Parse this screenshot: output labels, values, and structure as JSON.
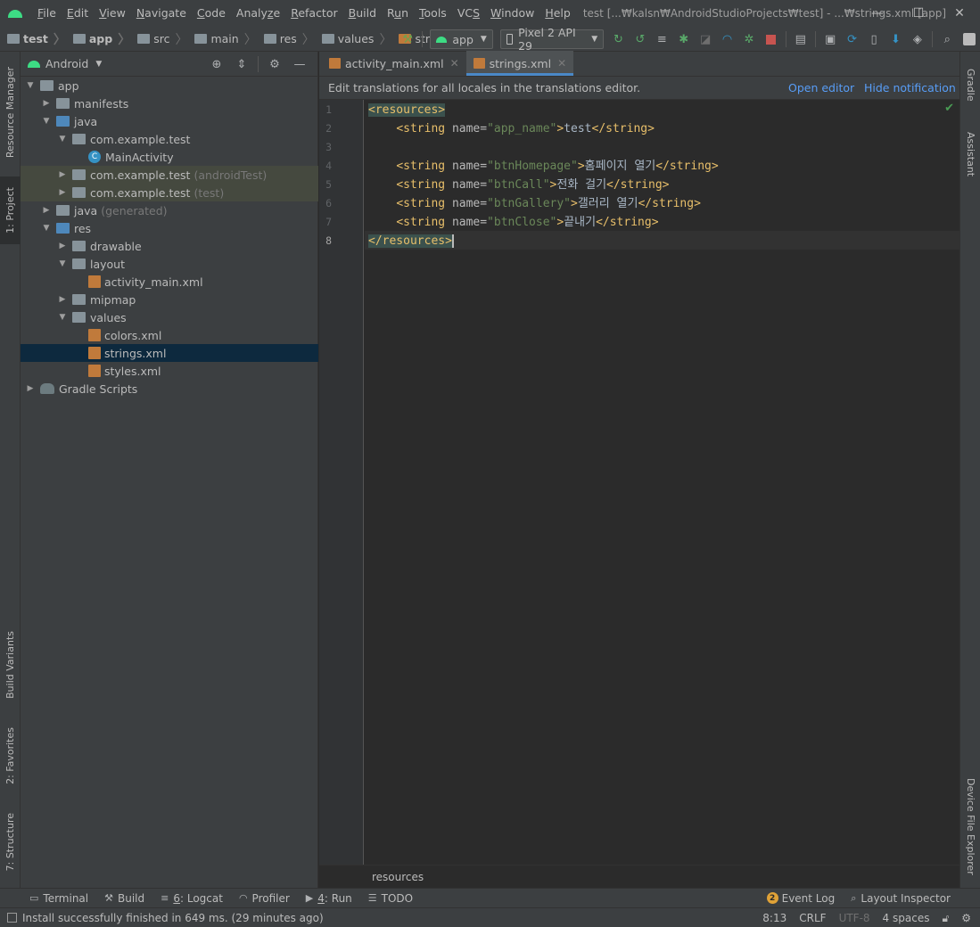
{
  "window": {
    "title": "test [...₩kalsn₩AndroidStudioProjects₩test] - ...₩strings.xml [app]",
    "minimize_glyph": "—",
    "maximize_glyph": "☐",
    "close_glyph": "✕"
  },
  "menu": [
    {
      "pre": "",
      "u": "F",
      "post": "ile"
    },
    {
      "pre": "",
      "u": "E",
      "post": "dit"
    },
    {
      "pre": "",
      "u": "V",
      "post": "iew"
    },
    {
      "pre": "",
      "u": "N",
      "post": "avigate"
    },
    {
      "pre": "",
      "u": "C",
      "post": "ode"
    },
    {
      "pre": "Analy",
      "u": "z",
      "post": "e"
    },
    {
      "pre": "",
      "u": "R",
      "post": "efactor"
    },
    {
      "pre": "",
      "u": "B",
      "post": "uild"
    },
    {
      "pre": "R",
      "u": "u",
      "post": "n"
    },
    {
      "pre": "",
      "u": "T",
      "post": "ools"
    },
    {
      "pre": "VC",
      "u": "S",
      "post": ""
    },
    {
      "pre": "",
      "u": "W",
      "post": "indow"
    },
    {
      "pre": "",
      "u": "H",
      "post": "elp"
    }
  ],
  "breadcrumbs": [
    {
      "label": "test",
      "bold": true
    },
    {
      "label": "app",
      "bold": true
    },
    {
      "label": "src",
      "bold": false
    },
    {
      "label": "main",
      "bold": false
    },
    {
      "label": "res",
      "bold": false
    },
    {
      "label": "values",
      "bold": false
    },
    {
      "label": "strings.xml",
      "bold": false
    }
  ],
  "toolbar": {
    "run_config": "app",
    "device": "Pixel 2 API 29"
  },
  "left_stripe": {
    "resource_manager": "Resource Manager",
    "project": "1: Project",
    "build_variants": "Build Variants",
    "favorites": "2: Favorites",
    "structure": "7: Structure"
  },
  "right_stripe": {
    "gradle": "Gradle",
    "assistant": "Assistant",
    "device_file_explorer": "Device File Explorer"
  },
  "project_panel": {
    "view_mode": "Android"
  },
  "tree": [
    {
      "label": "app",
      "suffix": "",
      "toggle": "▼",
      "icon": "module-folder-icon",
      "indent": 0
    },
    {
      "label": "manifests",
      "suffix": "",
      "toggle": "▶",
      "icon": "folder-icon",
      "indent": 1
    },
    {
      "label": "java",
      "suffix": "",
      "toggle": "▼",
      "icon": "source-folder-icon",
      "indent": 1
    },
    {
      "label": "com.example.test",
      "suffix": "",
      "toggle": "▼",
      "icon": "package-icon",
      "indent": 2
    },
    {
      "label": "MainActivity",
      "suffix": "",
      "toggle": "",
      "icon": "class-icon",
      "indent": 3
    },
    {
      "label": "com.example.test",
      "suffix": "(androidTest)",
      "toggle": "▶",
      "icon": "package-icon",
      "indent": 2
    },
    {
      "label": "com.example.test",
      "suffix": "(test)",
      "toggle": "▶",
      "icon": "package-icon",
      "indent": 2
    },
    {
      "label": "java",
      "suffix": "(generated)",
      "toggle": "▶",
      "icon": "generated-folder-icon",
      "indent": 1
    },
    {
      "label": "res",
      "suffix": "",
      "toggle": "▼",
      "icon": "res-folder-icon",
      "indent": 1
    },
    {
      "label": "drawable",
      "suffix": "",
      "toggle": "▶",
      "icon": "folder-icon",
      "indent": 2
    },
    {
      "label": "layout",
      "suffix": "",
      "toggle": "▼",
      "icon": "folder-icon",
      "indent": 2
    },
    {
      "label": "activity_main.xml",
      "suffix": "",
      "toggle": "",
      "icon": "xml-file-icon",
      "indent": 3
    },
    {
      "label": "mipmap",
      "suffix": "",
      "toggle": "▶",
      "icon": "folder-icon",
      "indent": 2
    },
    {
      "label": "values",
      "suffix": "",
      "toggle": "▼",
      "icon": "folder-icon",
      "indent": 2
    },
    {
      "label": "colors.xml",
      "suffix": "",
      "toggle": "",
      "icon": "xml-file-icon",
      "indent": 3
    },
    {
      "label": "strings.xml",
      "suffix": "",
      "toggle": "",
      "icon": "xml-file-icon",
      "indent": 3
    },
    {
      "label": "styles.xml",
      "suffix": "",
      "toggle": "",
      "icon": "xml-file-icon",
      "indent": 3
    },
    {
      "label": "Gradle Scripts",
      "suffix": "",
      "toggle": "▶",
      "icon": "gradle-icon",
      "indent": 0
    }
  ],
  "editor_tabs": [
    {
      "label": "activity_main.xml",
      "active": false
    },
    {
      "label": "strings.xml",
      "active": true
    }
  ],
  "notification": {
    "text": "Edit translations for all locales in the translations editor.",
    "open_editor": "Open editor",
    "hide": "Hide notification"
  },
  "code": {
    "line_numbers": [
      "1",
      "2",
      "3",
      "4",
      "5",
      "6",
      "7",
      "8"
    ],
    "open_tag": "<resources>",
    "close_tag": "</resources>",
    "string_open": "<string",
    "string_close": "</string>",
    "attr_name": "name=",
    "gt": ">",
    "entries": [
      {
        "line": 2,
        "key": "\"app_name\"",
        "value": "test"
      },
      {
        "line": 4,
        "key": "\"btnHomepage\"",
        "value": "홈페이지 열기"
      },
      {
        "line": 5,
        "key": "\"btnCall\"",
        "value": "전화 걸기"
      },
      {
        "line": 6,
        "key": "\"btnGallery\"",
        "value": "갤러리 열기"
      },
      {
        "line": 7,
        "key": "\"btnClose\"",
        "value": "끝내기"
      }
    ]
  },
  "editor_breadcrumb": "resources",
  "bottom_tools": {
    "terminal": "Terminal",
    "build": "Build",
    "logcat_num": "6",
    "logcat": ": Logcat",
    "profiler": "Profiler",
    "run_num": "4",
    "run": ": Run",
    "todo": "TODO",
    "event_log_count": "2",
    "event_log": "Event Log",
    "layout_inspector": "Layout Inspector"
  },
  "status": {
    "message": "Install successfully finished in 649 ms. (29 minutes ago)",
    "position": "8:13",
    "line_sep": "CRLF",
    "encoding": "UTF-8",
    "indent": "4 spaces"
  },
  "colors": {
    "background": "#2b2b2b",
    "panel": "#3c3f41",
    "selection": "#0d293e",
    "link": "#589df6",
    "xml_tag": "#e8bf6a",
    "xml_value": "#6a8759",
    "android_green": "#3ddc84"
  }
}
